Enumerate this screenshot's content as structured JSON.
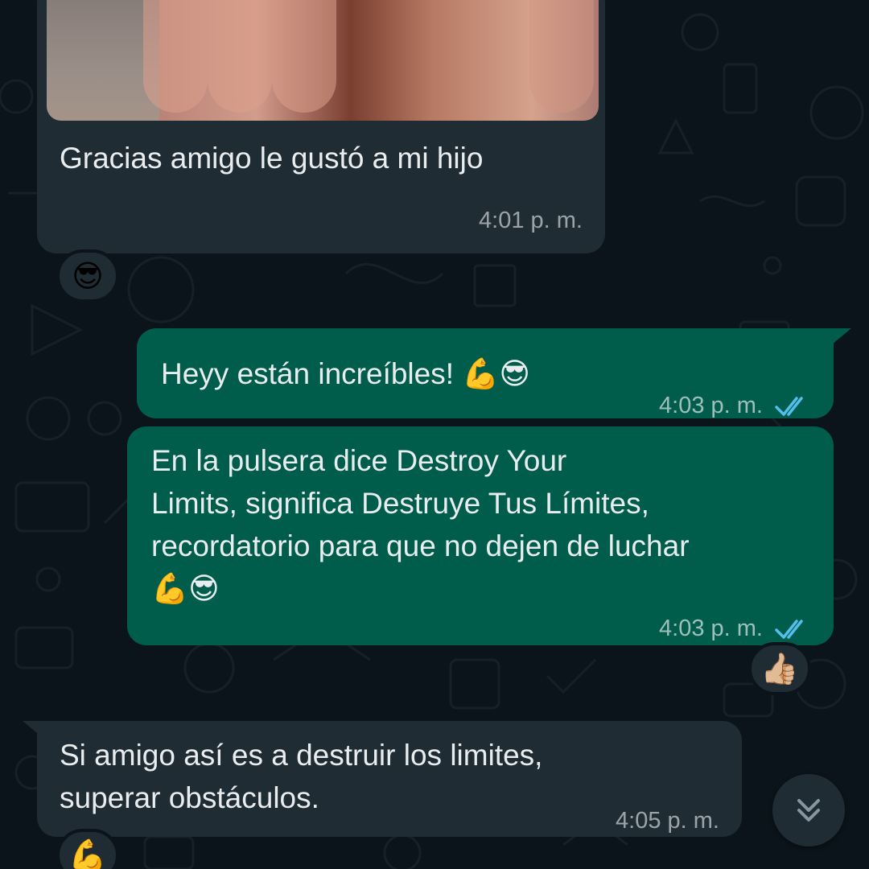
{
  "messages": [
    {
      "id": "m1",
      "direction": "incoming",
      "has_photo": true,
      "text": "Gracias amigo le gustó a mi hijo",
      "time": "4:01 p. m.",
      "reaction": "😎"
    },
    {
      "id": "m2",
      "direction": "outgoing",
      "text": "Heyy están increíbles! 💪😎",
      "time": "4:03 p. m.",
      "status": "read"
    },
    {
      "id": "m3",
      "direction": "outgoing",
      "text": "En la pulsera dice Destroy Your\nLimits, significa Destruye Tus Límites,\nrecordatorio para que no dejen de luchar\n💪😎",
      "time": "4:03 p. m.",
      "status": "read",
      "reaction": "👍🏼"
    },
    {
      "id": "m4",
      "direction": "incoming",
      "text": "Si amigo así es a destruir los limites,\nsuperar obstáculos.",
      "time": "4:05 p. m.",
      "reaction": "💪"
    }
  ],
  "colors": {
    "background": "#0b141a",
    "incoming_bubble": "#202c33",
    "outgoing_bubble": "#005c4b",
    "read_ticks": "#53bdeb"
  },
  "icons": {
    "read_receipt": "double-check-icon",
    "scroll_down": "double-chevron-down-icon"
  }
}
